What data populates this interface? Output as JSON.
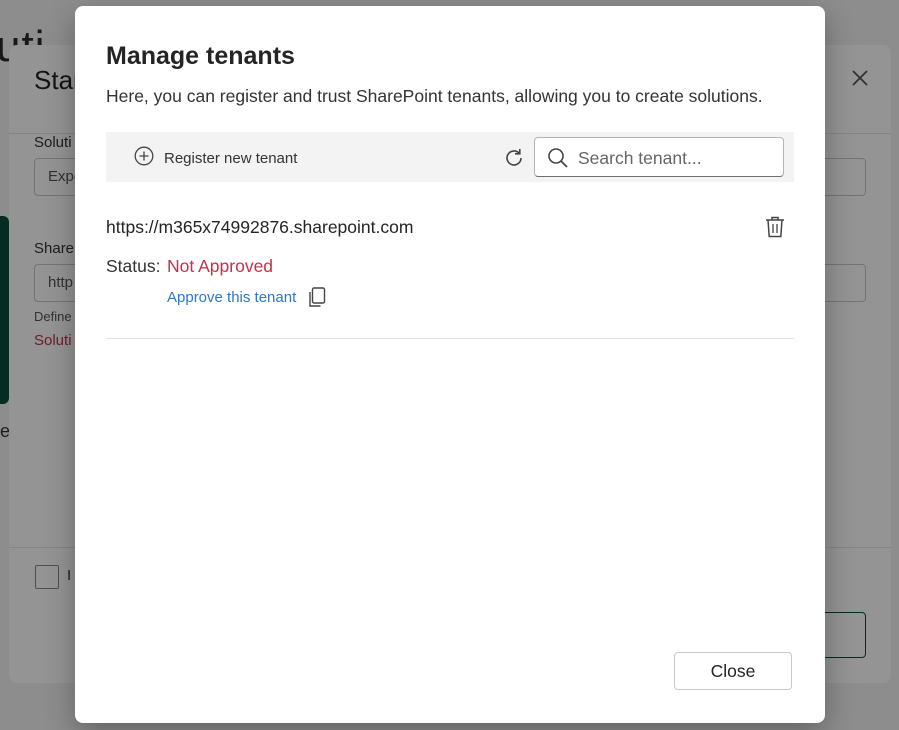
{
  "background": {
    "heading_fragment": "uti",
    "dialog_title_fragment": "Star",
    "solution_label": "Soluti",
    "solution_input": "Expe",
    "sharepoint_label": "ShareP",
    "sharepoint_input": "http",
    "hint_fragment": "Define",
    "error_fragment": "Soluti",
    "side_letter": "e",
    "checkbox_label_fragment": "I"
  },
  "modal": {
    "title": "Manage tenants",
    "description": "Here, you can register and trust SharePoint tenants, allowing you to create solutions.",
    "toolbar": {
      "register_label": "Register new tenant",
      "search_placeholder": "Search tenant..."
    },
    "tenants": [
      {
        "url": "https://m365x74992876.sharepoint.com",
        "status_label": "Status:",
        "status_value": "Not Approved",
        "approve_link": "Approve this tenant"
      }
    ],
    "close_label": "Close"
  },
  "colors": {
    "status_not_approved": "#c4314b",
    "link": "#2a78c7",
    "overlay": "rgba(0,0,0,0.42)"
  },
  "icons": {
    "register": "add-circle-icon",
    "refresh": "refresh-icon",
    "search": "search-icon",
    "delete": "trash-icon",
    "copy": "copy-icon",
    "close_x": "close-icon"
  }
}
